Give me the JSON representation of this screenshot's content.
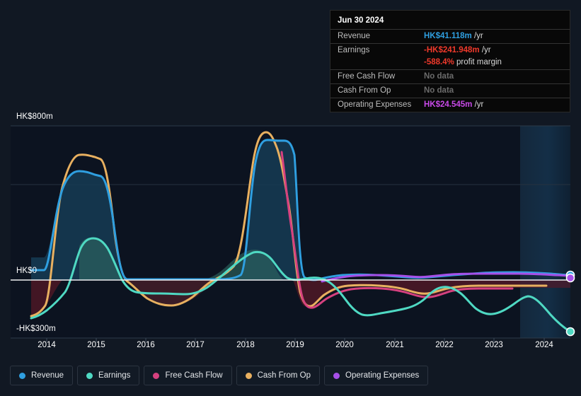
{
  "tooltip": {
    "date": "Jun 30 2024",
    "rows": [
      {
        "key": "Revenue",
        "amount": "HK$41.118m",
        "unit": "/yr",
        "style": "rev"
      },
      {
        "key": "Earnings",
        "amount": "-HK$241.948m",
        "unit": "/yr",
        "style": "neg"
      },
      {
        "key": "",
        "amount": "-588.4%",
        "unit": "profit margin",
        "style": "neg"
      },
      {
        "key": "Free Cash Flow",
        "amount": "No data",
        "unit": "",
        "style": "nodata"
      },
      {
        "key": "Cash From Op",
        "amount": "No data",
        "unit": "",
        "style": "nodata"
      },
      {
        "key": "Operating Expenses",
        "amount": "HK$24.545m",
        "unit": "/yr",
        "style": "opex"
      }
    ]
  },
  "axis": {
    "y_top_label": "HK$800m",
    "y_zero_label": "HK$0",
    "y_bottom_label": "-HK$300m",
    "x_labels": [
      "2014",
      "2015",
      "2016",
      "2017",
      "2018",
      "2019",
      "2020",
      "2021",
      "2022",
      "2023",
      "2024"
    ]
  },
  "legend": {
    "items": [
      {
        "label": "Revenue",
        "color": "#2f9fe0"
      },
      {
        "label": "Earnings",
        "color": "#4fd9c3"
      },
      {
        "label": "Free Cash Flow",
        "color": "#d6417f"
      },
      {
        "label": "Cash From Op",
        "color": "#e8b060"
      },
      {
        "label": "Operating Expenses",
        "color": "#a64fe8"
      }
    ]
  },
  "chart_data": {
    "type": "area",
    "title": "",
    "xlabel": "",
    "ylabel": "HK$",
    "currency": "HK$",
    "unit": "m",
    "ylim": [
      -300,
      800
    ],
    "y_gridlines": [
      800,
      400,
      0
    ],
    "x": [
      "2013.8",
      "2014",
      "2014.5",
      "2015",
      "2015.4",
      "2016",
      "2016.5",
      "2017",
      "2017.6",
      "2018",
      "2018.5",
      "2019",
      "2019.5",
      "2020",
      "2020.5",
      "2021",
      "2021.5",
      "2022",
      "2022.5",
      "2023",
      "2023.5",
      "2024",
      "2024.5"
    ],
    "x_range": [
      2013.7,
      2024.6
    ],
    "forecast_start": "2023.6",
    "grid": true,
    "legend_position": "bottom",
    "series": [
      {
        "name": "Revenue",
        "color": "#2f9fe0",
        "fill": "#14384f",
        "values": [
          48,
          48,
          500,
          480,
          30,
          30,
          30,
          30,
          35,
          660,
          680,
          40,
          55,
          60,
          55,
          45,
          45,
          50,
          50,
          55,
          60,
          55,
          41.118
        ]
      },
      {
        "name": "Earnings",
        "color": "#4fd9c3",
        "fill": "#2b6059",
        "values": [
          -275,
          -255,
          175,
          160,
          20,
          15,
          -55,
          -50,
          -10,
          85,
          150,
          120,
          30,
          -60,
          -200,
          -175,
          -35,
          -95,
          -115,
          -160,
          -85,
          -185,
          -241.948
        ]
      },
      {
        "name": "Free Cash Flow",
        "color": "#d6417f",
        "fill": "#4a1624",
        "values": [
          null,
          null,
          null,
          null,
          null,
          null,
          null,
          null,
          null,
          null,
          560,
          -160,
          -60,
          -25,
          -20,
          -22,
          -60,
          -75,
          -50,
          -45,
          -45,
          null,
          null
        ]
      },
      {
        "name": "Cash From Op",
        "color": "#e8b060",
        "fill": "#3d3522",
        "values": [
          -285,
          -250,
          520,
          500,
          -60,
          -90,
          -130,
          -110,
          -35,
          720,
          600,
          -165,
          -70,
          -30,
          -25,
          -25,
          -70,
          -80,
          -50,
          -48,
          -48,
          -45,
          null
        ]
      },
      {
        "name": "Operating Expenses",
        "color": "#a64fe8",
        "fill": "#3a1f50",
        "values": [
          null,
          null,
          null,
          null,
          null,
          null,
          null,
          null,
          null,
          null,
          null,
          null,
          null,
          35,
          40,
          38,
          35,
          38,
          40,
          45,
          48,
          46,
          24.545
        ]
      }
    ],
    "endpoint_markers": [
      {
        "series": "Revenue",
        "x": "2024.5",
        "y": 41.118,
        "color": "#2f9fe0"
      },
      {
        "series": "Operating Expenses",
        "x": "2024.5",
        "y": 24.545,
        "color": "#a64fe8"
      },
      {
        "series": "Earnings",
        "x": "2024.5",
        "y": -241.948,
        "color": "#4fd9c3"
      }
    ]
  },
  "colors": {
    "background": "#111823",
    "plot_background": "#0d1420",
    "forecast_band": "#16293c",
    "gridline": "#32404f",
    "zero_line": "#e8eaed",
    "text": "#ffffff"
  }
}
